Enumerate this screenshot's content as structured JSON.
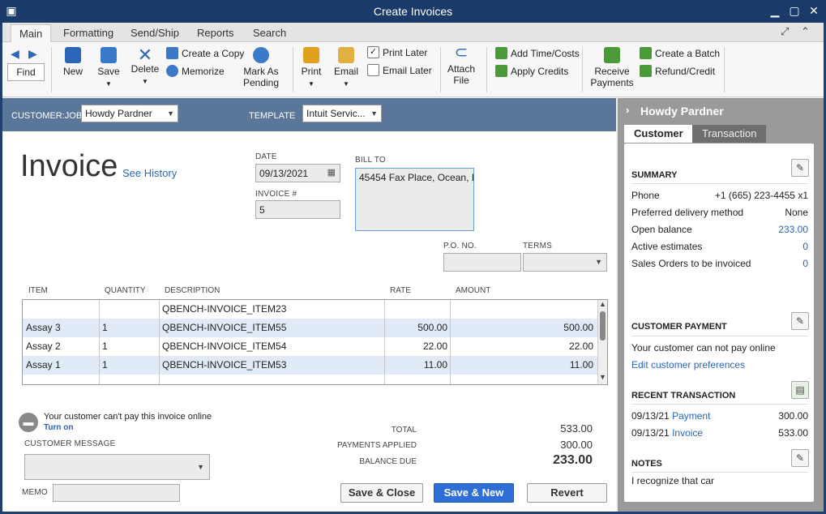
{
  "window": {
    "title": "Create Invoices"
  },
  "ribbon_tabs": [
    "Main",
    "Formatting",
    "Send/Ship",
    "Reports",
    "Search"
  ],
  "ribbon": {
    "find": "Find",
    "new": "New",
    "save": "Save",
    "delete": "Delete",
    "create_copy": "Create a Copy",
    "memorize": "Memorize",
    "mark_as_pending_1": "Mark As",
    "mark_as_pending_2": "Pending",
    "print": "Print",
    "email": "Email",
    "print_later": "Print Later",
    "email_later": "Email Later",
    "attach_file_1": "Attach",
    "attach_file_2": "File",
    "add_time_costs": "Add Time/Costs",
    "apply_credits": "Apply Credits",
    "receive_payments_1": "Receive",
    "receive_payments_2": "Payments",
    "create_batch": "Create a Batch",
    "refund_credit": "Refund/Credit"
  },
  "customer_bar": {
    "customer_job_label": "CUSTOMER:JOB",
    "customer_job_value": "Howdy Pardner",
    "template_label": "TEMPLATE",
    "template_value": "Intuit Servic..."
  },
  "invoice": {
    "title": "Invoice",
    "see_history": "See History",
    "date_label": "DATE",
    "date_value": "09/13/2021",
    "invoice_no_label": "INVOICE #",
    "invoice_no_value": "5",
    "bill_to_label": "BILL TO",
    "bill_to_value": "45454 Fax Place, Ocean, I",
    "po_label": "P.O. NO.",
    "terms_label": "TERMS"
  },
  "grid": {
    "headers": [
      "ITEM",
      "QUANTITY",
      "DESCRIPTION",
      "RATE",
      "AMOUNT"
    ],
    "rows": [
      {
        "item": "",
        "qty": "",
        "desc": "QBENCH-INVOICE_ITEM23",
        "rate": "",
        "amount": ""
      },
      {
        "item": "Assay 3",
        "qty": "1",
        "desc": "QBENCH-INVOICE_ITEM55",
        "rate": "500.00",
        "amount": "500.00"
      },
      {
        "item": "Assay 2",
        "qty": "1",
        "desc": "QBENCH-INVOICE_ITEM54",
        "rate": "22.00",
        "amount": "22.00"
      },
      {
        "item": "Assay 1",
        "qty": "1",
        "desc": "QBENCH-INVOICE_ITEM53",
        "rate": "11.00",
        "amount": "11.00"
      }
    ]
  },
  "footer": {
    "online_msg": "Your customer can't pay this invoice online",
    "turn_on": "Turn on",
    "customer_message_label": "CUSTOMER MESSAGE",
    "memo_label": "MEMO",
    "total_label": "TOTAL",
    "total_value": "533.00",
    "payments_label": "PAYMENTS APPLIED",
    "payments_value": "300.00",
    "balance_label": "BALANCE DUE",
    "balance_value": "233.00",
    "save_close": "Save & Close",
    "save_new": "Save & New",
    "revert": "Revert"
  },
  "side": {
    "name": "Howdy Pardner",
    "tab_customer": "Customer",
    "tab_transaction": "Transaction",
    "summary_title": "SUMMARY",
    "summary": [
      {
        "label": "Phone",
        "value": "+1 (665) 223-4455 x1"
      },
      {
        "label": "Preferred delivery method",
        "value": "None"
      },
      {
        "label": "Open balance",
        "value": "233.00"
      },
      {
        "label": "Active estimates",
        "value": "0"
      },
      {
        "label": "Sales Orders to be invoiced",
        "value": "0"
      }
    ],
    "payment_title": "CUSTOMER PAYMENT",
    "payment_msg": "Your customer can not pay online",
    "edit_prefs": "Edit customer preferences",
    "recent_title": "RECENT TRANSACTION",
    "recent": [
      {
        "date": "09/13/21",
        "type": "Payment",
        "amount": "300.00"
      },
      {
        "date": "09/13/21",
        "type": "Invoice",
        "amount": "533.00"
      }
    ],
    "notes_title": "NOTES",
    "notes": "I recognize that car"
  },
  "colors": {
    "accent": "#2e6ed6",
    "customer_bar": "#5a7799",
    "title_bar": "#1a3a6a"
  }
}
